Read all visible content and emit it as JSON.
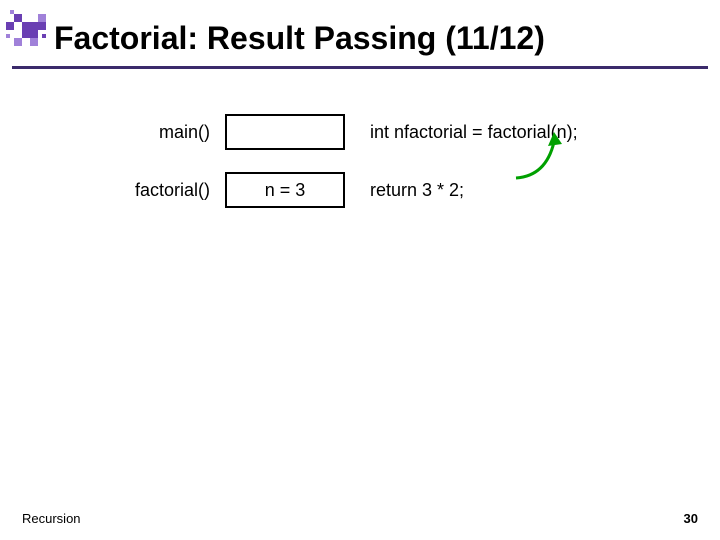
{
  "slide": {
    "title": "Factorial: Result Passing (11/12)",
    "footer_label": "Recursion",
    "page_number": "30"
  },
  "rows": [
    {
      "fn": "main()",
      "box": "",
      "code": "int nfactorial = factorial(n);"
    },
    {
      "fn": "factorial()",
      "box": "n = 3",
      "code": "return 3 * 2;"
    }
  ],
  "arrow": {
    "color": "#00a000",
    "desc": "return-to-caller-arrow"
  }
}
